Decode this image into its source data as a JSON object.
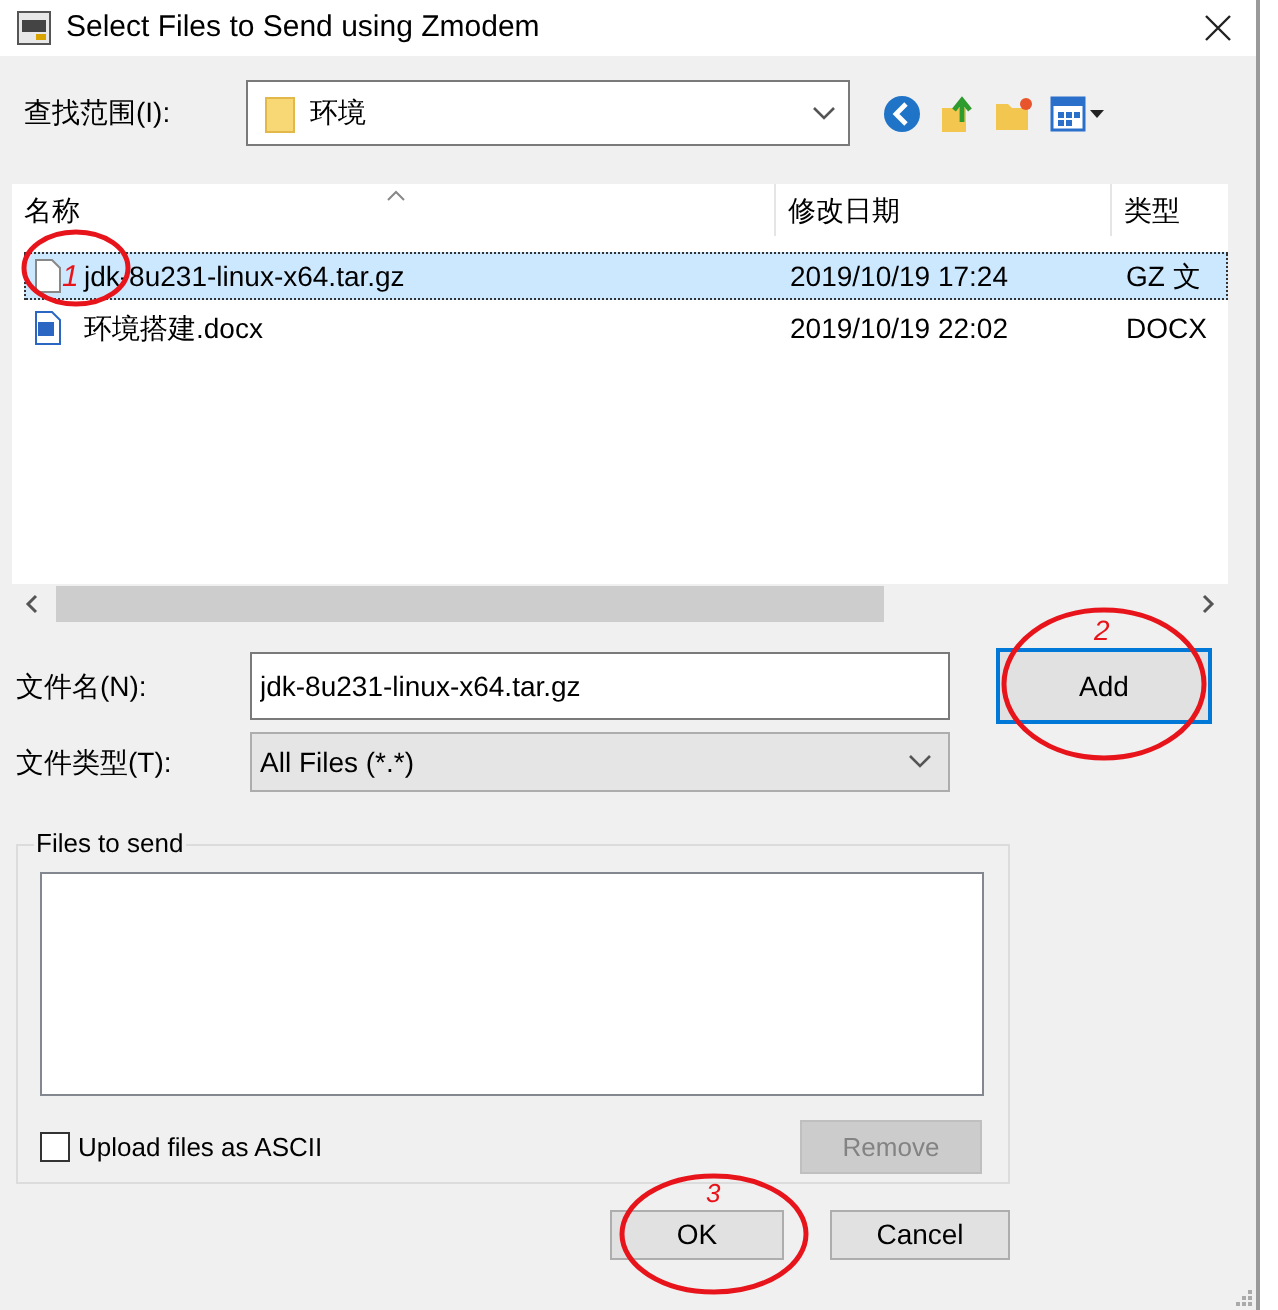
{
  "window": {
    "title": "Select Files to Send using Zmodem"
  },
  "look_in": {
    "label": "查找范围(I):",
    "value": "环境"
  },
  "file_list": {
    "columns": [
      "名称",
      "修改日期",
      "类型"
    ],
    "rows": [
      {
        "name": "jdk-8u231-linux-x64.tar.gz",
        "modified": "2019/10/19 17:24",
        "type": "GZ 文",
        "kind": "archive",
        "selected": true
      },
      {
        "name": "环境搭建.docx",
        "modified": "2019/10/19 22:02",
        "type": "DOCX",
        "kind": "document",
        "selected": false
      }
    ]
  },
  "file_name": {
    "label": "文件名(N):",
    "value": "jdk-8u231-linux-x64.tar.gz"
  },
  "file_type": {
    "label": "文件类型(T):",
    "value": "All Files (*.*)"
  },
  "add_button": "Add",
  "files_to_send": {
    "label": "Files to send",
    "upload_ascii": {
      "label": "Upload files as ASCII",
      "checked": false
    },
    "remove_button": {
      "label": "Remove",
      "disabled": true
    }
  },
  "buttons": [
    "OK",
    "Cancel"
  ],
  "annotations": [
    {
      "label": "1"
    },
    {
      "label": "2"
    },
    {
      "label": "3"
    }
  ]
}
